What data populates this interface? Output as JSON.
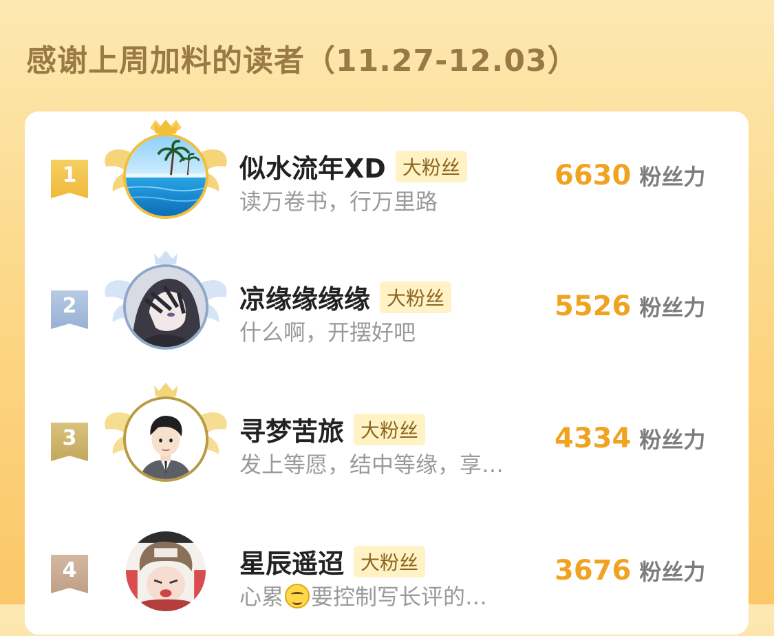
{
  "header": {
    "title": "感谢上周加料的读者（11.27-12.03）"
  },
  "readers": [
    {
      "rank": "1",
      "name": "似水流年XD",
      "badge": "大粉丝",
      "motto": "读万卷书，行万里路",
      "score": "6630",
      "score_unit": "粉丝力",
      "tier_color": "#f2c14a"
    },
    {
      "rank": "2",
      "name": "凉缘缘缘缘",
      "badge": "大粉丝",
      "motto": "什么啊，开摆好吧",
      "score": "5526",
      "score_unit": "粉丝力",
      "tier_color": "#a9bfdc"
    },
    {
      "rank": "3",
      "name": "寻梦苦旅",
      "badge": "大粉丝",
      "motto": "发上等愿，结中等缘，享…",
      "score": "4334",
      "score_unit": "粉丝力",
      "tier_color": "#cdb36a"
    },
    {
      "rank": "4",
      "name": "星辰遥迢",
      "badge": "大粉丝",
      "motto_before": "心累",
      "motto_emoji": "sweat-smile-emoji",
      "motto_after": "要控制写长评的…",
      "score": "3676",
      "score_unit": "粉丝力",
      "tier_color": "#c9ab93"
    }
  ]
}
